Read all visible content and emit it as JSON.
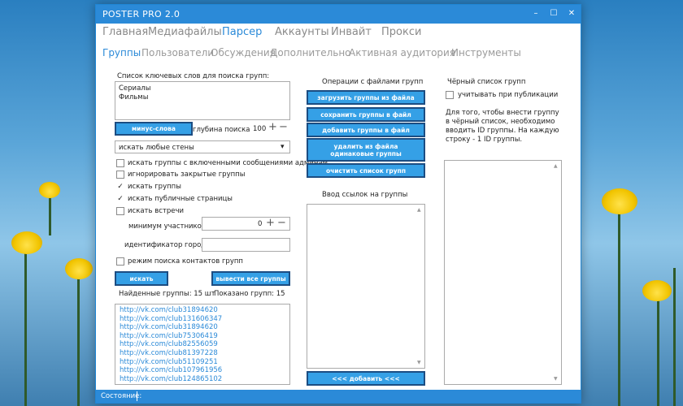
{
  "window": {
    "title": "POSTER PRO 2.0",
    "controls": {
      "minimize": "–",
      "maximize": "☐",
      "close": "✕"
    }
  },
  "menu": {
    "main": [
      "Главная",
      "Медиафайлы",
      "Парсер",
      "Аккаунты",
      "Инвайт",
      "Прокси"
    ],
    "active_main": "Парсер",
    "sub": [
      "Группы",
      "Пользователи",
      "Обсуждения",
      "Дополнительно",
      "Активная аудитория",
      "Инструменты"
    ],
    "active_sub": "Группы"
  },
  "left": {
    "keywords_label": "Список ключевых слов для поиска групп:",
    "keywords": [
      "Сериалы",
      "Фильмы"
    ],
    "minus_button": "минус-слова",
    "depth_label": "глубина поиска",
    "depth_value": "100",
    "walls_select": "искать любые стены",
    "checkboxes": [
      {
        "label": "искать группы с включенными сообщениями админам",
        "checked": false
      },
      {
        "label": "игнорировать закрытые группы",
        "checked": false
      },
      {
        "label": "искать группы",
        "checked": true
      },
      {
        "label": "искать публичные страницы",
        "checked": true
      },
      {
        "label": "искать встречи",
        "checked": false
      }
    ],
    "min_members_label": "минимум участников",
    "min_members_value": "0",
    "city_id_label": "идентификатор города",
    "city_id_value": "",
    "contacts_mode_label": "режим поиска контактов групп",
    "contacts_mode_checked": false,
    "search_button": "искать",
    "show_all_button": "вывести все группы",
    "found_label": "Найденные группы: 15 шт",
    "shown_label": "Показано групп: 15",
    "groups": [
      "http://vk.com/club31894620",
      "http://vk.com/club131606347",
      "http://vk.com/club31894620",
      "http://vk.com/club75306419",
      "http://vk.com/club82556059",
      "http://vk.com/club81397228",
      "http://vk.com/club51109251",
      "http://vk.com/club107961956",
      "http://vk.com/club124865102"
    ]
  },
  "middle": {
    "ops_label": "Операции с файлами групп",
    "buttons": [
      "загрузить группы из файла",
      "сохранить группы в файл",
      "добавить группы в файл",
      "удалить из файла одинаковые группы",
      "очистить список групп"
    ],
    "links_label": "Ввод ссылок на группы",
    "links_value": "",
    "add_button": "<<< добавить <<<"
  },
  "right": {
    "blacklist_label": "Чёрный список групп",
    "publish_checkbox": "учитывать при публикации",
    "publish_checked": false,
    "help_text": "Для того, чтобы внести группу в чёрный список, необходимо вводить ID группы. На каждую строку - 1 ID группы.",
    "blacklist_value": ""
  },
  "status": {
    "label": "Состояние:"
  },
  "colors": {
    "accent": "#2b8ad8",
    "button": "#35a0e6",
    "button_border": "#1c4d82"
  },
  "icons": {
    "plus": "+",
    "minus": "−",
    "dropdown": "▾",
    "check": "✓",
    "scroll_up": "▲",
    "scroll_down": "▼"
  }
}
